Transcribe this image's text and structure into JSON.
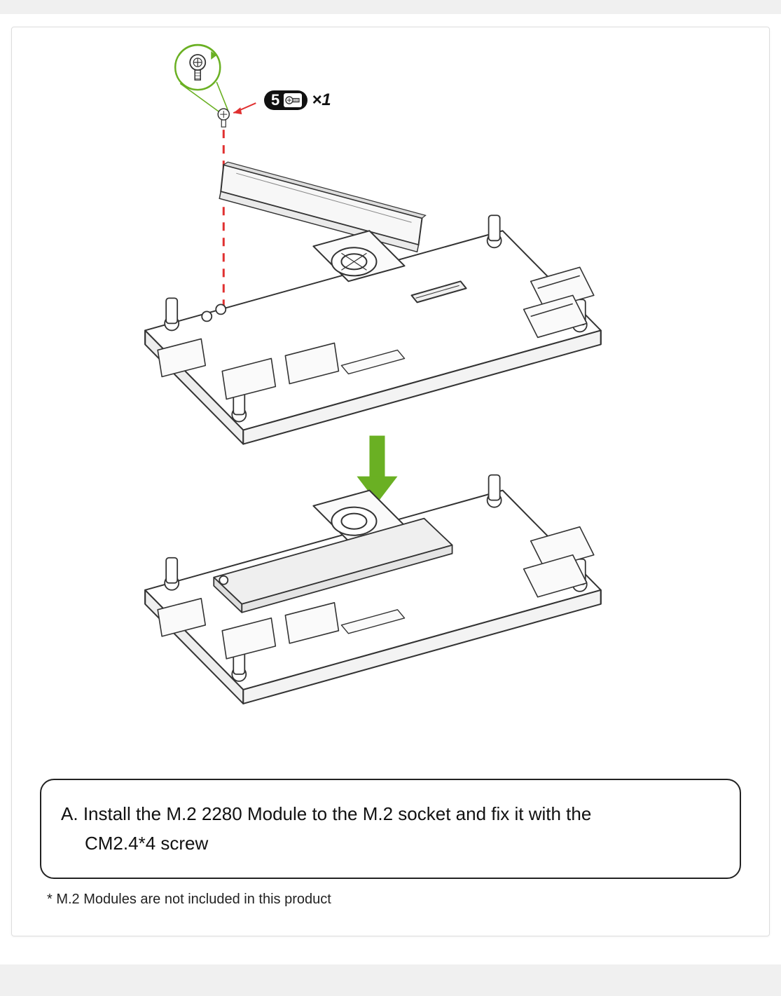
{
  "callout": {
    "step_number": "5",
    "screw_icon": "screw-icon",
    "quantity_label": "×1"
  },
  "diagram": {
    "screw_detail_icon": "screw-detail-icon",
    "screw_drop_icon": "screw-small-icon",
    "m2_module_icon": "m2-2280-module",
    "board_top_icon": "carrier-board-before",
    "arrow_icon": "down-arrow-icon",
    "board_bottom_icon": "carrier-board-after",
    "screw_path_icon": "screw-insertion-path",
    "callout_arrow_icon": "callout-arrow"
  },
  "instruction": {
    "label": "A.",
    "text_line1": "Install the M.2 2280 Module to the M.2 socket and fix it with the",
    "text_line2": "CM2.4*4 screw"
  },
  "footnote": {
    "text": "* M.2 Modules are not included in this product"
  },
  "colors": {
    "accent_green": "#6ab023",
    "accent_red": "#e03030",
    "line": "#222222"
  }
}
